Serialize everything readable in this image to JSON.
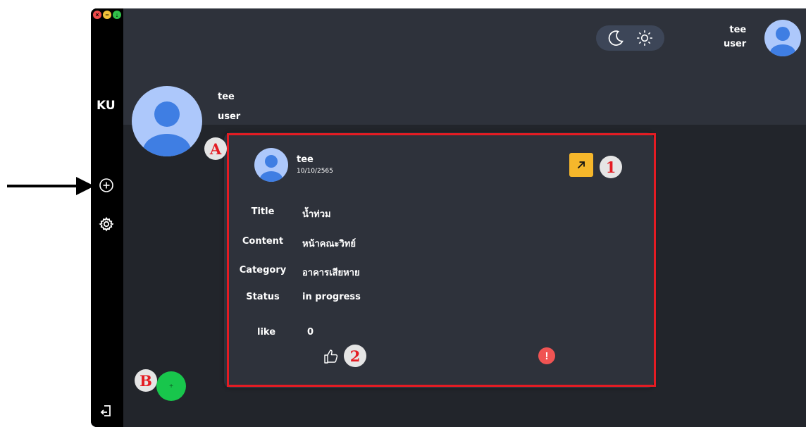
{
  "window": {
    "controls": [
      "close",
      "minimize",
      "maximize"
    ]
  },
  "sidebar": {
    "logo": "KU",
    "items": [
      {
        "name": "create-post",
        "icon": "plus-circle-icon"
      },
      {
        "name": "settings",
        "icon": "gear-icon"
      },
      {
        "name": "logout",
        "icon": "logout-icon"
      }
    ]
  },
  "header": {
    "theme_toggle": [
      "moon-icon",
      "sun-icon"
    ],
    "user": {
      "name": "tee",
      "role": "user"
    }
  },
  "profile": {
    "name": "tee",
    "role": "user"
  },
  "post": {
    "author": "tee",
    "date": "10/10/2565",
    "fields": [
      {
        "label": "Title",
        "value": "น้ำท่วม"
      },
      {
        "label": "Content",
        "value": "หน้าคณะวิทย์"
      },
      {
        "label": "Category",
        "value": "อาคารเสียหาย"
      },
      {
        "label": "Status",
        "value": "in progress"
      },
      {
        "label": "like",
        "value": "0"
      }
    ]
  },
  "fab": {
    "label": "+"
  },
  "annotations": {
    "card_marker": "A",
    "fab_marker": "B",
    "open_marker": "1",
    "like_marker": "2"
  },
  "colors": {
    "sidebar": "#000000",
    "topbar": "#2e323b",
    "content_bg": "#22252b",
    "card": "#2e323b",
    "accent_yellow": "#f6b72b",
    "fab_green": "#18c64c",
    "report_red": "#f05453",
    "annotation_red": "#e41c23",
    "avatar": "#adc8fb"
  }
}
